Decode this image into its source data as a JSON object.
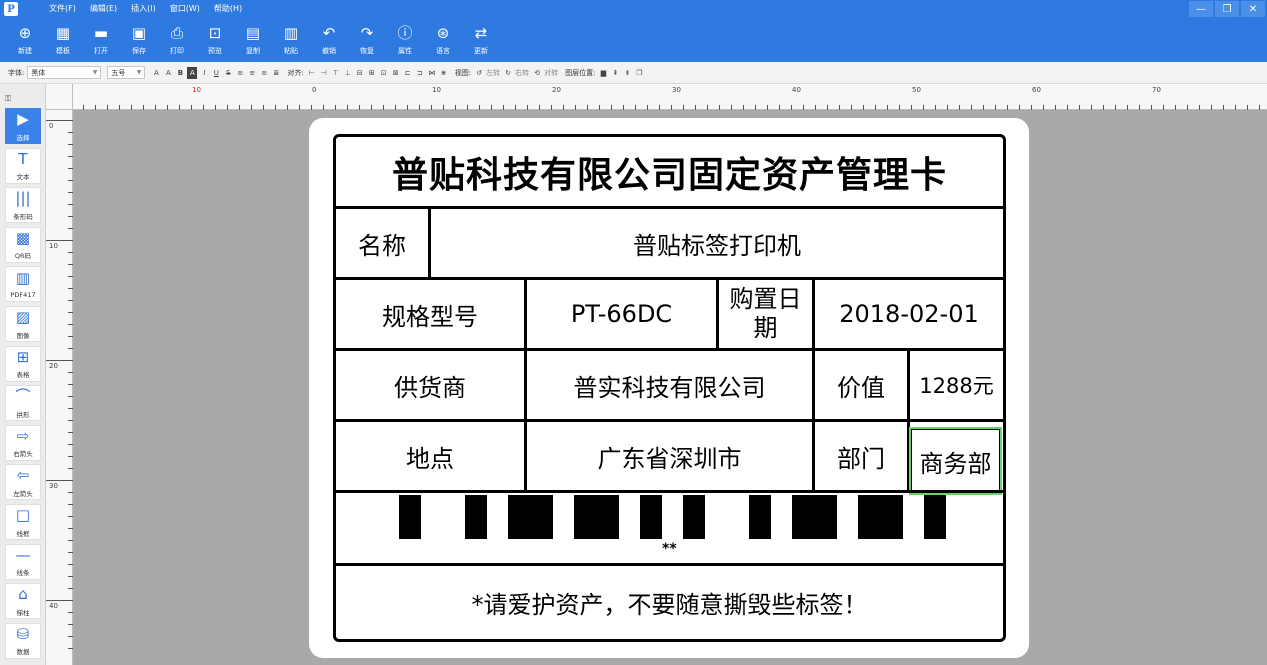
{
  "app": {
    "logo_text": "P",
    "menu": [
      "文件(F)",
      "编辑(E)",
      "插入(I)",
      "窗口(W)",
      "帮助(H)"
    ],
    "window_controls": {
      "minimize": "—",
      "restore": "❐",
      "close": "✕"
    }
  },
  "ribbon": [
    {
      "label": "新建",
      "icon": "plus-icon",
      "glyph": "⊕"
    },
    {
      "label": "模板",
      "icon": "template-icon",
      "glyph": "▦"
    },
    {
      "label": "打开",
      "icon": "folder-icon",
      "glyph": "▬"
    },
    {
      "label": "保存",
      "icon": "save-icon",
      "glyph": "▣"
    },
    {
      "label": "打印",
      "icon": "print-icon",
      "glyph": "⎙"
    },
    {
      "label": "预览",
      "icon": "preview-icon",
      "glyph": "⊡"
    },
    {
      "label": "复制",
      "icon": "copy-icon",
      "glyph": "▤"
    },
    {
      "label": "粘贴",
      "icon": "paste-icon",
      "glyph": "▥"
    },
    {
      "label": "撤销",
      "icon": "undo-icon",
      "glyph": "↶"
    },
    {
      "label": "恢复",
      "icon": "redo-icon",
      "glyph": "↷"
    },
    {
      "label": "属性",
      "icon": "info-icon",
      "glyph": "ⓘ"
    },
    {
      "label": "语言",
      "icon": "language-icon",
      "glyph": "⊛"
    },
    {
      "label": "更新",
      "icon": "refresh-icon",
      "glyph": "⇄"
    }
  ],
  "format_bar": {
    "font_label": "字体:",
    "font_value": "黑体",
    "size_value": "五号",
    "align_label": "对齐:",
    "rotate_label": "视图:",
    "rotate_left": "左转",
    "rotate_right": "右转",
    "rotate_reset": "对转",
    "layer_label": "图层位置:"
  },
  "tools": [
    {
      "label": "选择",
      "icon": "select-arrow-icon",
      "glyph": "▶",
      "active": true
    },
    {
      "label": "文本",
      "icon": "text-icon",
      "glyph": "T"
    },
    {
      "label": "条形码",
      "icon": "barcode-icon",
      "glyph": "|||"
    },
    {
      "label": "QR码",
      "icon": "qrcode-icon",
      "glyph": "▩"
    },
    {
      "label": "PDF417",
      "icon": "pdf417-icon",
      "glyph": "▥"
    },
    {
      "label": "图像",
      "icon": "image-icon",
      "glyph": "▨"
    },
    {
      "label": "表格",
      "icon": "table-icon",
      "glyph": "⊞"
    },
    {
      "label": "拱形",
      "icon": "arch-icon",
      "glyph": "⌒"
    },
    {
      "label": "右箭头",
      "icon": "right-arrow-icon",
      "glyph": "⇨"
    },
    {
      "label": "左箭头",
      "icon": "left-arrow-icon",
      "glyph": "⇦"
    },
    {
      "label": "线框",
      "icon": "rectangle-icon",
      "glyph": "□"
    },
    {
      "label": "线条",
      "icon": "line-icon",
      "glyph": "—"
    },
    {
      "label": "梯柱",
      "icon": "pentagon-icon",
      "glyph": "⌂"
    },
    {
      "label": "数据",
      "icon": "database-icon",
      "glyph": "⛁"
    }
  ],
  "ruler": {
    "h_labels": [
      "10",
      "0",
      "10",
      "20",
      "30",
      "40",
      "50",
      "60",
      "70"
    ],
    "v_labels": [
      "0",
      "10",
      "20",
      "30",
      "40"
    ]
  },
  "label": {
    "title": "普贴科技有限公司固定资产管理卡",
    "name_key": "名称",
    "name_value": "普贴标签打印机",
    "model_key": "规格型号",
    "model_value": "PT-66DC",
    "date_key": "购置日期",
    "date_value": "2018-02-01",
    "supplier_key": "供货商",
    "supplier_value": "普实科技有限公司",
    "price_key": "价值",
    "price_value": "1288元",
    "location_key": "地点",
    "location_value": "广东省深圳市",
    "dept_key": "部门",
    "dept_value": "商务部",
    "barcode_text": "**",
    "footer": "*请爱护资产，不要随意撕毁些标签！"
  },
  "colors": {
    "accent": "#2f7ae0",
    "selection": "#6ad26a"
  }
}
